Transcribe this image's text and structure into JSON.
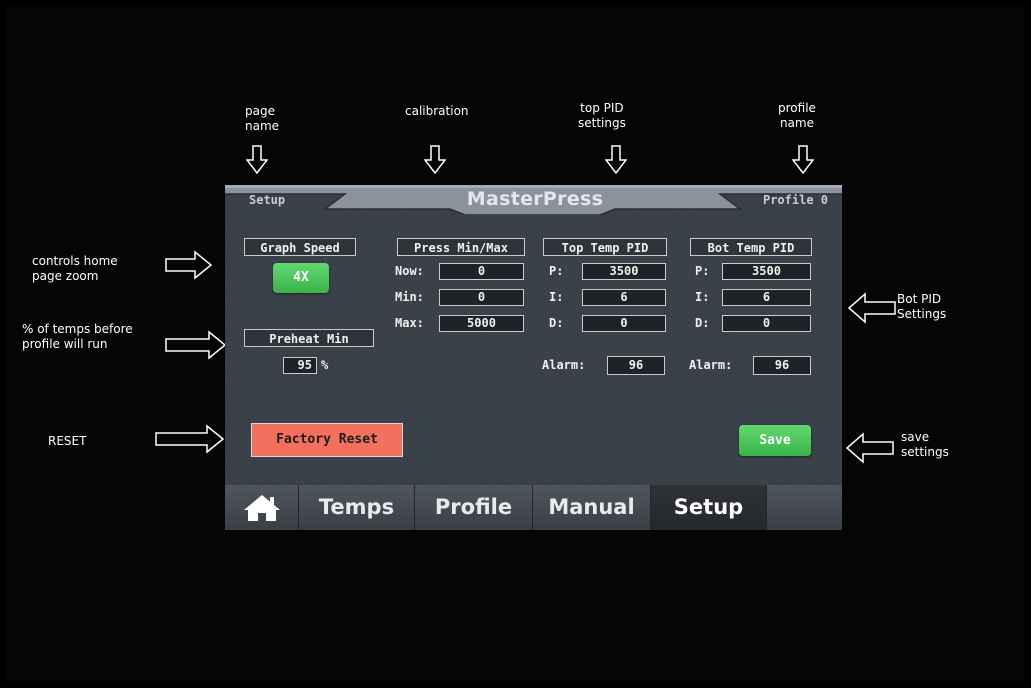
{
  "annotations": {
    "page_name": "page\nname",
    "calibration": "calibration",
    "top_pid": "top PID\nsettings",
    "profile_name": "profile\nname",
    "home_zoom": "controls home\npage zoom",
    "temps_before": "% of temps before\nprofile will run",
    "reset": "RESET",
    "bot_pid": "Bot PID\nSettings",
    "save_settings": "save\nsettings"
  },
  "screen": {
    "page_name": "Setup",
    "app_title": "MasterPress",
    "profile_name": "Profile 0",
    "graph_speed": {
      "label": "Graph Speed",
      "value": "4X"
    },
    "preheat": {
      "label": "Preheat Min",
      "value": "95",
      "unit": "%"
    },
    "press": {
      "label": "Press Min/Max",
      "now_label": "Now:",
      "now_value": "0",
      "min_label": "Min:",
      "min_value": "0",
      "max_label": "Max:",
      "max_value": "5000"
    },
    "top_pid": {
      "label": "Top Temp PID",
      "p_label": "P:",
      "p_value": "3500",
      "i_label": "I:",
      "i_value": "6",
      "d_label": "D:",
      "d_value": "0",
      "alarm_label": "Alarm:",
      "alarm_value": "96"
    },
    "bot_pid": {
      "label": "Bot Temp PID",
      "p_label": "P:",
      "p_value": "3500",
      "i_label": "I:",
      "i_value": "6",
      "d_label": "D:",
      "d_value": "0",
      "alarm_label": "Alarm:",
      "alarm_value": "96"
    },
    "factory_reset": "Factory Reset",
    "save": "Save",
    "tabs": [
      "Temps",
      "Profile",
      "Manual",
      "Setup"
    ],
    "active_tab": "Setup"
  },
  "colors": {
    "green_button": "#3ab34a",
    "reset_button": "#f2715e",
    "panel": "#3a4048"
  },
  "icons": [
    "home-icon",
    "arrow-down-icon",
    "arrow-right-icon",
    "arrow-left-icon"
  ]
}
